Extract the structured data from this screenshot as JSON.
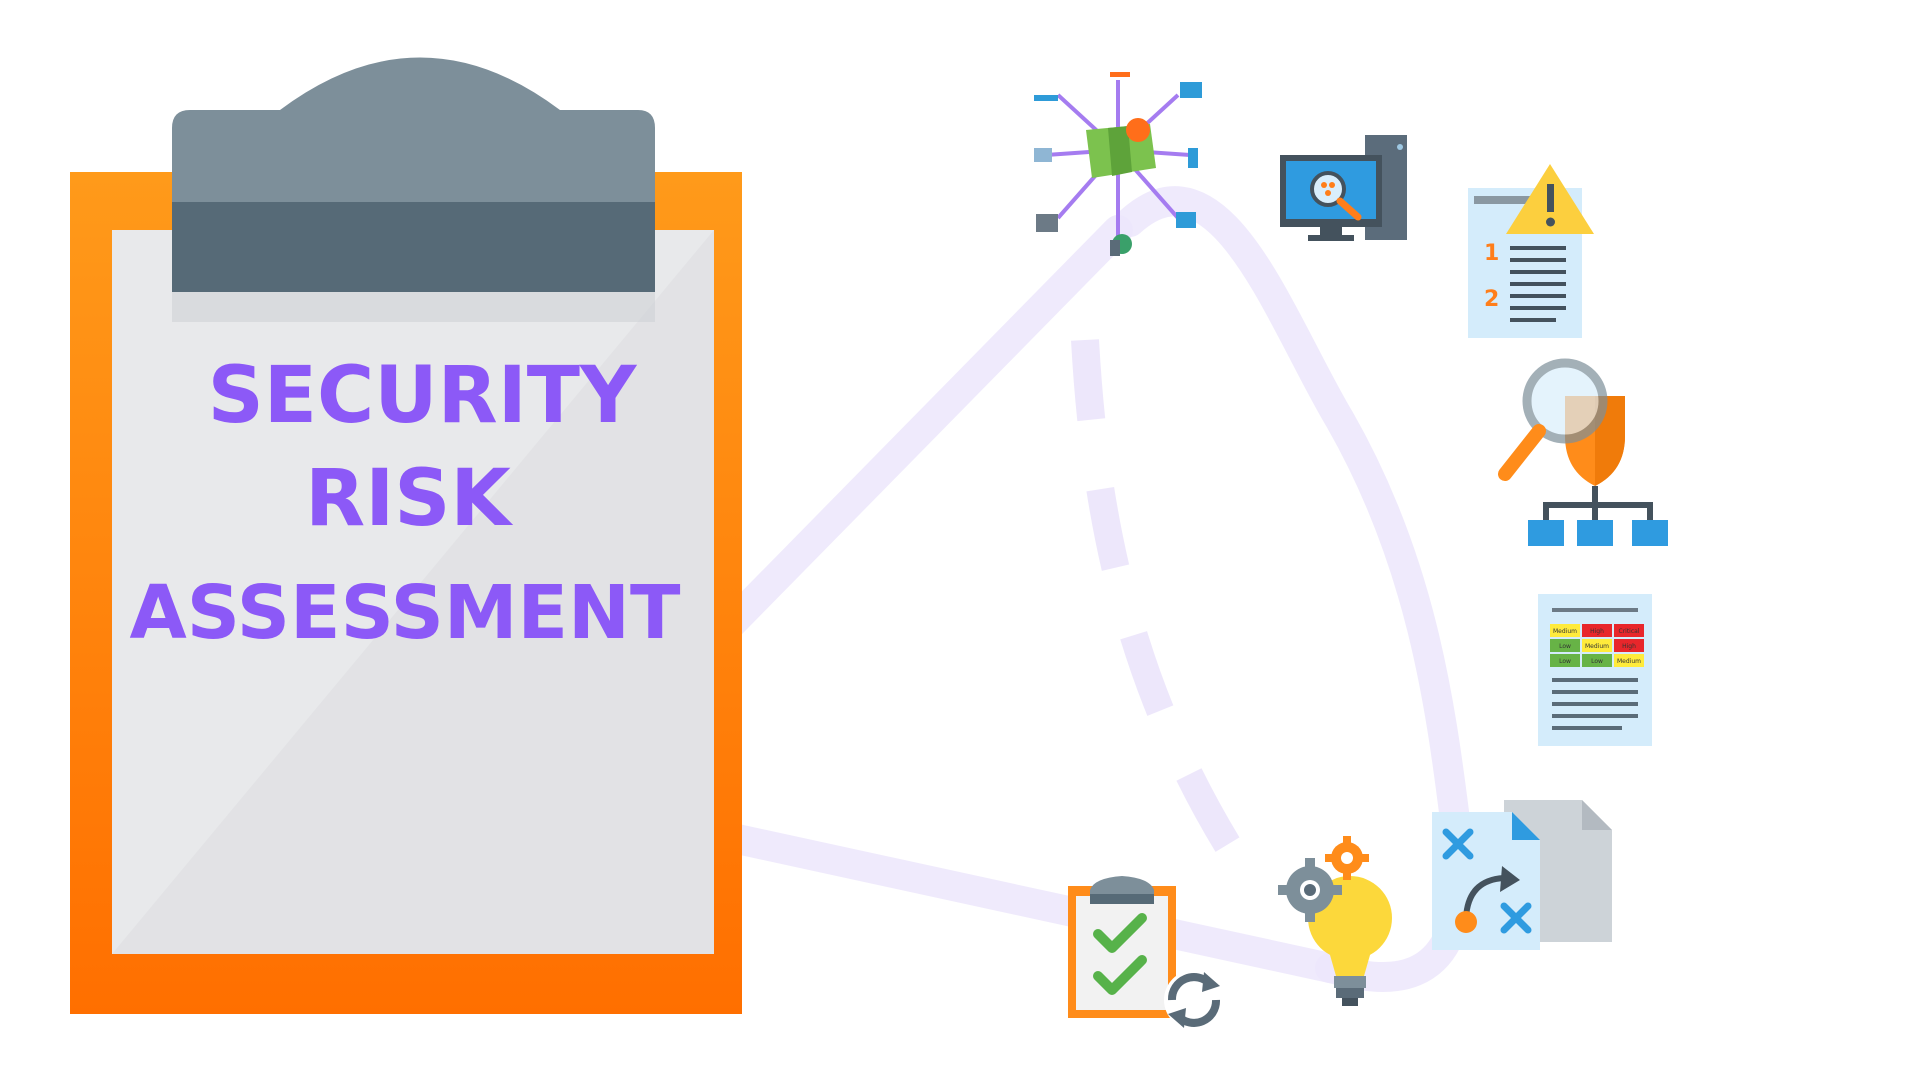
{
  "title": {
    "line1": "SECURITY",
    "line2": "RISK",
    "line3": "ASSESSMENT"
  },
  "risk_matrix": {
    "row1": [
      "Medium",
      "High",
      "Critical"
    ],
    "row2": [
      "Low",
      "Medium",
      "High"
    ],
    "row3": [
      "Low",
      "Low",
      "Medium"
    ]
  },
  "report_numbers": [
    "1",
    "2"
  ],
  "colors": {
    "accent_purple": "#8c59f7",
    "clipboard_orange": "#ff8c00",
    "clip_gray": "#7d8f9a",
    "path_lavender": "#ece6fb"
  }
}
